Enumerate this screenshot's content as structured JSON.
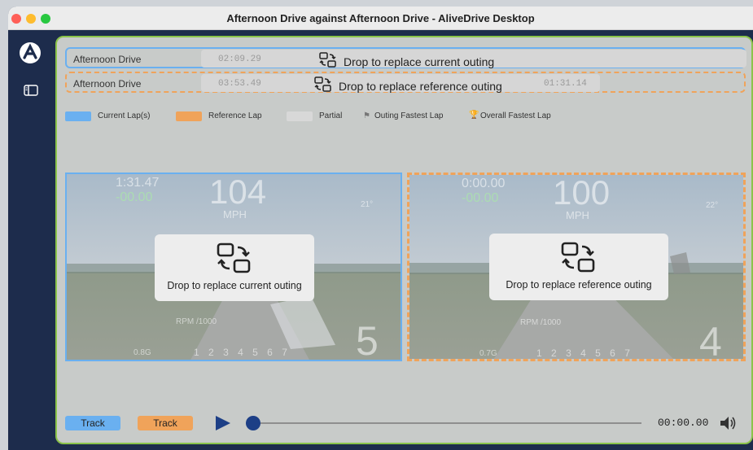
{
  "window": {
    "title": "Afternoon Drive against Afternoon Drive - AliveDrive Desktop",
    "traffic_lights": [
      "#ff5f57",
      "#febc2e",
      "#28c840"
    ]
  },
  "sidebar": {
    "icons": [
      "alivedrive-logo-icon",
      "sidebar-toggle-icon"
    ]
  },
  "current_row": {
    "name": "Afternoon Drive",
    "time": "02:09.29",
    "drop_label": "Drop to replace current outing",
    "color": "#6ab0f0"
  },
  "reference_row": {
    "name": "Afternoon Drive",
    "time": "03:53.49",
    "drop_label": "Drop to replace reference outing",
    "time2": "01:31.14",
    "color": "#f0a35a"
  },
  "legend": {
    "current": "Current Lap(s)",
    "reference": "Reference Lap",
    "partial": "Partial",
    "outing_fastest": "Outing Fastest Lap",
    "overall_fastest": "Overall Fastest Lap"
  },
  "left_video": {
    "lap_time": "1:31.47",
    "delta": "-00.00",
    "speed": "104",
    "speed_unit": "MPH",
    "angle": "21°",
    "rpm_label": "RPM /1000",
    "gforce": "0.8G",
    "gears": [
      "1",
      "2",
      "3",
      "4",
      "5",
      "6",
      "7"
    ],
    "gear": "5",
    "drop_label": "Drop to replace current outing"
  },
  "right_video": {
    "lap_time": "0:00.00",
    "delta": "-00.00",
    "speed": "100",
    "speed_unit": "MPH",
    "angle": "22°",
    "rpm_label": "RPM /1000",
    "gforce": "0.7G",
    "gears": [
      "1",
      "2",
      "3",
      "4",
      "5",
      "6",
      "7"
    ],
    "gear": "4",
    "drop_label": "Drop to replace reference outing"
  },
  "controls": {
    "track_current": "Track",
    "track_reference": "Track",
    "time": "00:00.00",
    "progress": 0
  }
}
